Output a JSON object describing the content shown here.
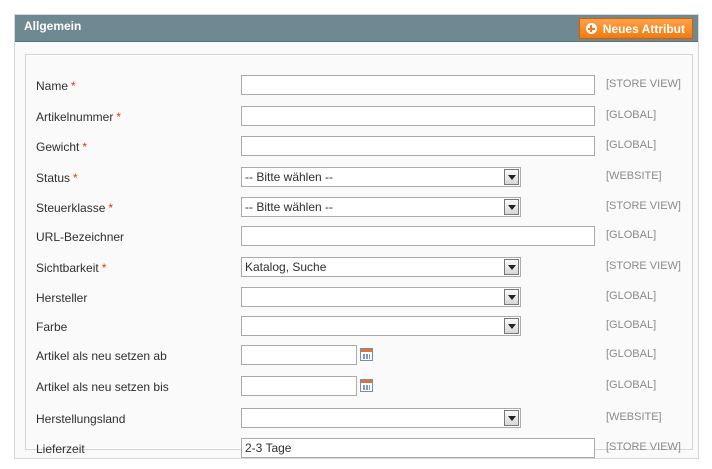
{
  "panel": {
    "title": "Allgemein",
    "new_attribute_label": "Neues Attribut",
    "new_attribute_icon": "plus-circle-icon",
    "accent_color": "#f07a10",
    "header_color": "#6f8992"
  },
  "fields": [
    {
      "label": "Name",
      "required": "*",
      "type": "text",
      "value": "",
      "scope": "[STORE VIEW]"
    },
    {
      "label": "Artikelnummer",
      "required": "*",
      "type": "text",
      "value": "",
      "scope": "[GLOBAL]"
    },
    {
      "label": "Gewicht",
      "required": "*",
      "type": "text",
      "value": "",
      "scope": "[GLOBAL]"
    },
    {
      "label": "Status",
      "required": "*",
      "type": "select",
      "value": "-- Bitte wählen --",
      "scope": "[WEBSITE]"
    },
    {
      "label": "Steuerklasse",
      "required": "*",
      "type": "select",
      "value": "-- Bitte wählen --",
      "scope": "[STORE VIEW]"
    },
    {
      "label": "URL-Bezeichner",
      "required": "",
      "type": "text",
      "value": "",
      "scope": "[GLOBAL]"
    },
    {
      "label": "Sichtbarkeit",
      "required": "*",
      "type": "select",
      "value": "Katalog, Suche",
      "scope": "[STORE VIEW]"
    },
    {
      "label": "Hersteller",
      "required": "",
      "type": "select",
      "value": "",
      "scope": "[GLOBAL]"
    },
    {
      "label": "Farbe",
      "required": "",
      "type": "select",
      "value": "",
      "scope": "[GLOBAL]"
    },
    {
      "label": "Artikel als neu setzen ab",
      "required": "",
      "type": "date",
      "value": "",
      "scope": "[GLOBAL]"
    },
    {
      "label": "Artikel als neu setzen bis",
      "required": "",
      "type": "date",
      "value": "",
      "scope": "[GLOBAL]"
    },
    {
      "label": "Herstellungsland",
      "required": "",
      "type": "select",
      "value": "",
      "scope": "[WEBSITE]"
    },
    {
      "label": "Lieferzeit",
      "required": "",
      "type": "text",
      "value": "2-3 Tage",
      "scope": "[STORE VIEW]"
    }
  ]
}
